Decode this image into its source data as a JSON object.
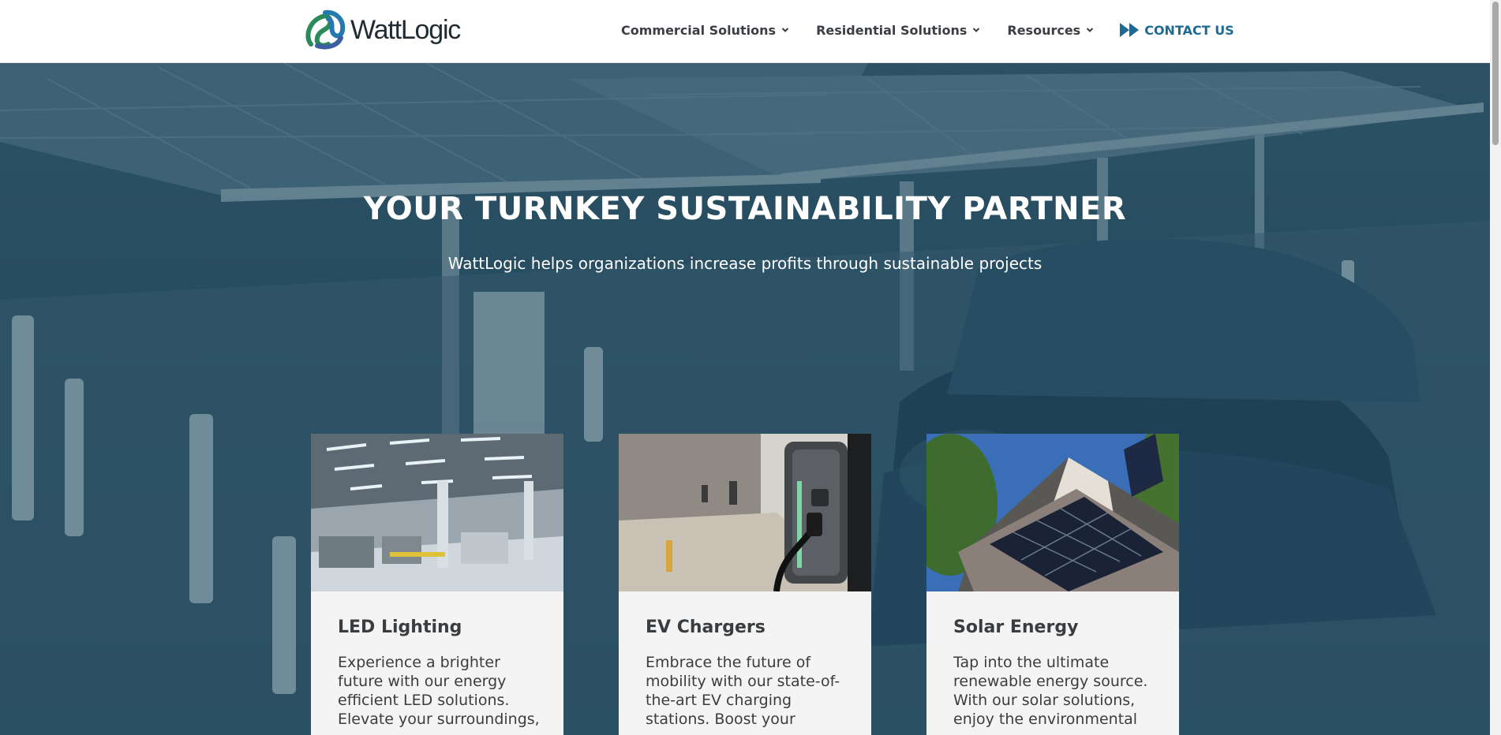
{
  "header": {
    "logo": {
      "text": "WattLogic"
    },
    "nav": [
      {
        "label": "Commercial Solutions",
        "icon": "chevron-down-icon"
      },
      {
        "label": "Residential Solutions",
        "icon": "chevron-down-icon"
      },
      {
        "label": "Resources",
        "icon": "chevron-down-icon"
      }
    ],
    "contact": {
      "label": "CONTACT US",
      "icon": "double-arrow-icon"
    }
  },
  "hero": {
    "title": "YOUR TURNKEY SUSTAINABILITY PARTNER",
    "subtitle": "WattLogic helps organizations increase profits through sustainable projects"
  },
  "cards": [
    {
      "title": "LED Lighting",
      "text": "Experience a brighter future with our energy efficient LED solutions. Elevate your surroundings,"
    },
    {
      "title": "EV Chargers",
      "text": "Embrace the future of mobility with our state-of-the-art EV charging stations. Boost your"
    },
    {
      "title": "Solar Energy",
      "text": "Tap into the ultimate renewable energy source. With our solar solutions, enjoy the environmental"
    }
  ],
  "colors": {
    "accent": "#1d6a94",
    "hero_overlay": "#18445c",
    "card_bg": "#f4f4f4",
    "text_dark": "#3a3d40"
  }
}
